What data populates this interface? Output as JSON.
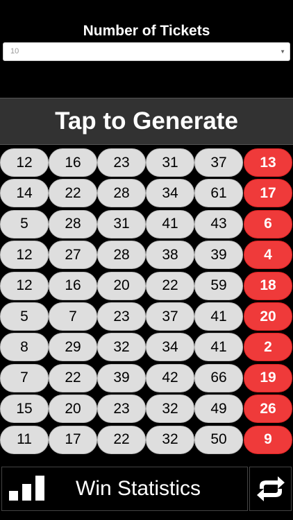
{
  "header": {
    "title": "Number of Tickets",
    "select_value": "10"
  },
  "generate": {
    "label": "Tap to Generate"
  },
  "tickets": [
    {
      "numbers": [
        "12",
        "16",
        "23",
        "31",
        "37"
      ],
      "power": "13"
    },
    {
      "numbers": [
        "14",
        "22",
        "28",
        "34",
        "61"
      ],
      "power": "17"
    },
    {
      "numbers": [
        "5",
        "28",
        "31",
        "41",
        "43"
      ],
      "power": "6"
    },
    {
      "numbers": [
        "12",
        "27",
        "28",
        "38",
        "39"
      ],
      "power": "4"
    },
    {
      "numbers": [
        "12",
        "16",
        "20",
        "22",
        "59"
      ],
      "power": "18"
    },
    {
      "numbers": [
        "5",
        "7",
        "23",
        "37",
        "41"
      ],
      "power": "20"
    },
    {
      "numbers": [
        "8",
        "29",
        "32",
        "34",
        "41"
      ],
      "power": "2"
    },
    {
      "numbers": [
        "7",
        "22",
        "39",
        "42",
        "66"
      ],
      "power": "19"
    },
    {
      "numbers": [
        "15",
        "20",
        "23",
        "32",
        "49"
      ],
      "power": "26"
    },
    {
      "numbers": [
        "11",
        "17",
        "22",
        "32",
        "50"
      ],
      "power": "9"
    }
  ],
  "footer": {
    "stats_label": "Win Statistics",
    "stats_icon": "bar-chart-icon",
    "refresh_icon": "swap-arrows-icon"
  },
  "colors": {
    "power_ball": "#ef3a3a",
    "ball": "#dedede",
    "generate_bg": "#323232"
  }
}
